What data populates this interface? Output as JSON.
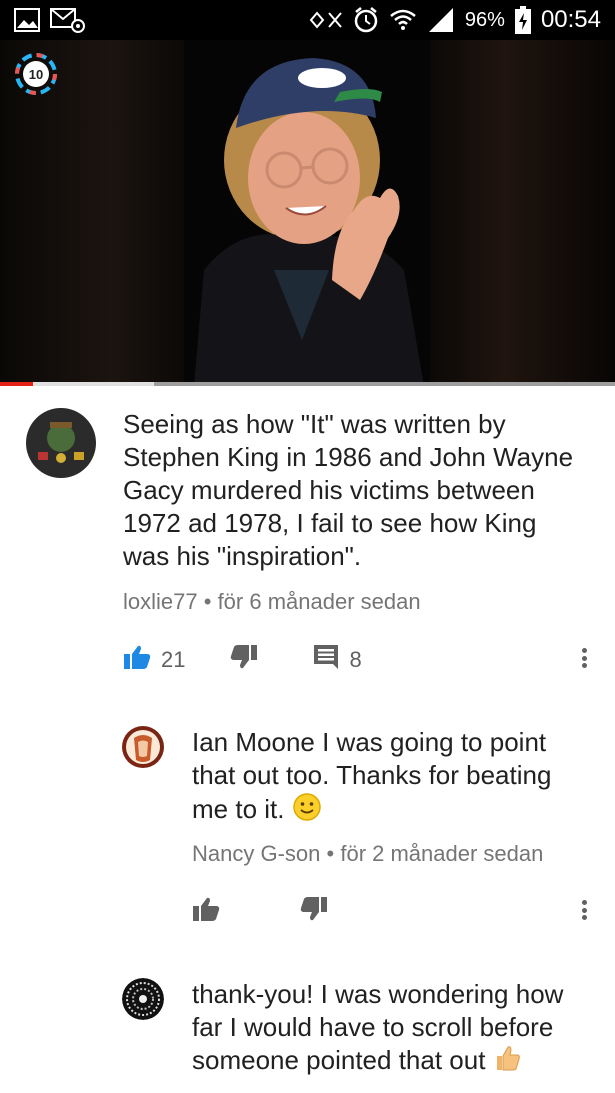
{
  "status_bar": {
    "battery_percent": "96%",
    "time": "00:54",
    "icons": [
      "gallery-icon",
      "email-at-icon",
      "nfc-icon",
      "alarm-icon",
      "wifi-icon",
      "signal-icon",
      "battery-charging-icon"
    ]
  },
  "video": {
    "channel_badge": "10",
    "progress_played": 0.054,
    "progress_buffered": 0.25
  },
  "comments": [
    {
      "text": "Seeing as how \"It\" was written by Stephen King in 1986 and John Wayne Gacy murdered his victims between 1972 ad 1978, I fail to see how King was his \"inspiration\".",
      "author": "loxlie77",
      "separator": "•",
      "time": "för 6 månader sedan",
      "likes": "21",
      "replies": "8"
    },
    {
      "text": "Ian Moone I was going to point that out too. Thanks for beating me to it.",
      "emoji": "slightly-smiling-face",
      "author": "Nancy G-son",
      "separator": "•",
      "time": "för 2 månader sedan"
    },
    {
      "text": "thank-you! I was wondering how far I would have to scroll before someone pointed that out",
      "emoji": "thumbs-up"
    }
  ],
  "colors": {
    "like_active": "#1e88e5",
    "meta_text": "#757575",
    "progress_red": "#e62117"
  }
}
